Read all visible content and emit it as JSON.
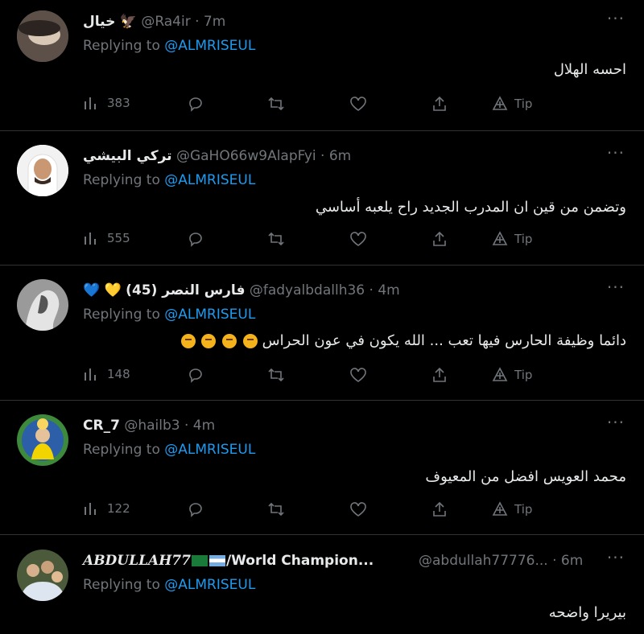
{
  "colors": {
    "accent": "#1d9bf0",
    "muted": "#71767b",
    "text": "#e7e9ea",
    "divider": "#2f3336"
  },
  "replying_prefix": "Replying to",
  "tweets": [
    {
      "name": "خيال",
      "handle": "@Ra4ir",
      "time": "· 7m",
      "mention": "@ALMRISEUL",
      "text": "احسه الهلال",
      "views": "383",
      "tip": "Tip"
    },
    {
      "name": "تركي البيشي",
      "handle": "@GaHO66w9AlapFyi",
      "time": "· 6m",
      "mention": "@ALMRISEUL",
      "text": "وتضمن من قين ان المدرب الجديد راح يلعبه أساسي",
      "views": "555",
      "tip": "Tip"
    },
    {
      "name": "فارس النصر (45)",
      "handle": "@fadyalbdallh36",
      "time": "· 4m",
      "mention": "@ALMRISEUL",
      "text": "دائما وظيفة الحارس فيها تعب ... الله يكون في عون الحراس",
      "views": "148",
      "tip": "Tip"
    },
    {
      "name": "CR_7",
      "handle": "@hailb3",
      "time": "· 4m",
      "mention": "@ALMRISEUL",
      "text": "محمد العويس افضل من المعيوف",
      "views": "122",
      "tip": "Tip"
    },
    {
      "name": "𝑨𝑩𝑫𝑼𝑳𝑳𝑨𝑯77",
      "name_suffix": "/World Champion...",
      "handle": "@abdullah77776...",
      "time": "· 6m",
      "mention": "@ALMRISEUL",
      "text": "بيريرا واضحه"
    }
  ]
}
